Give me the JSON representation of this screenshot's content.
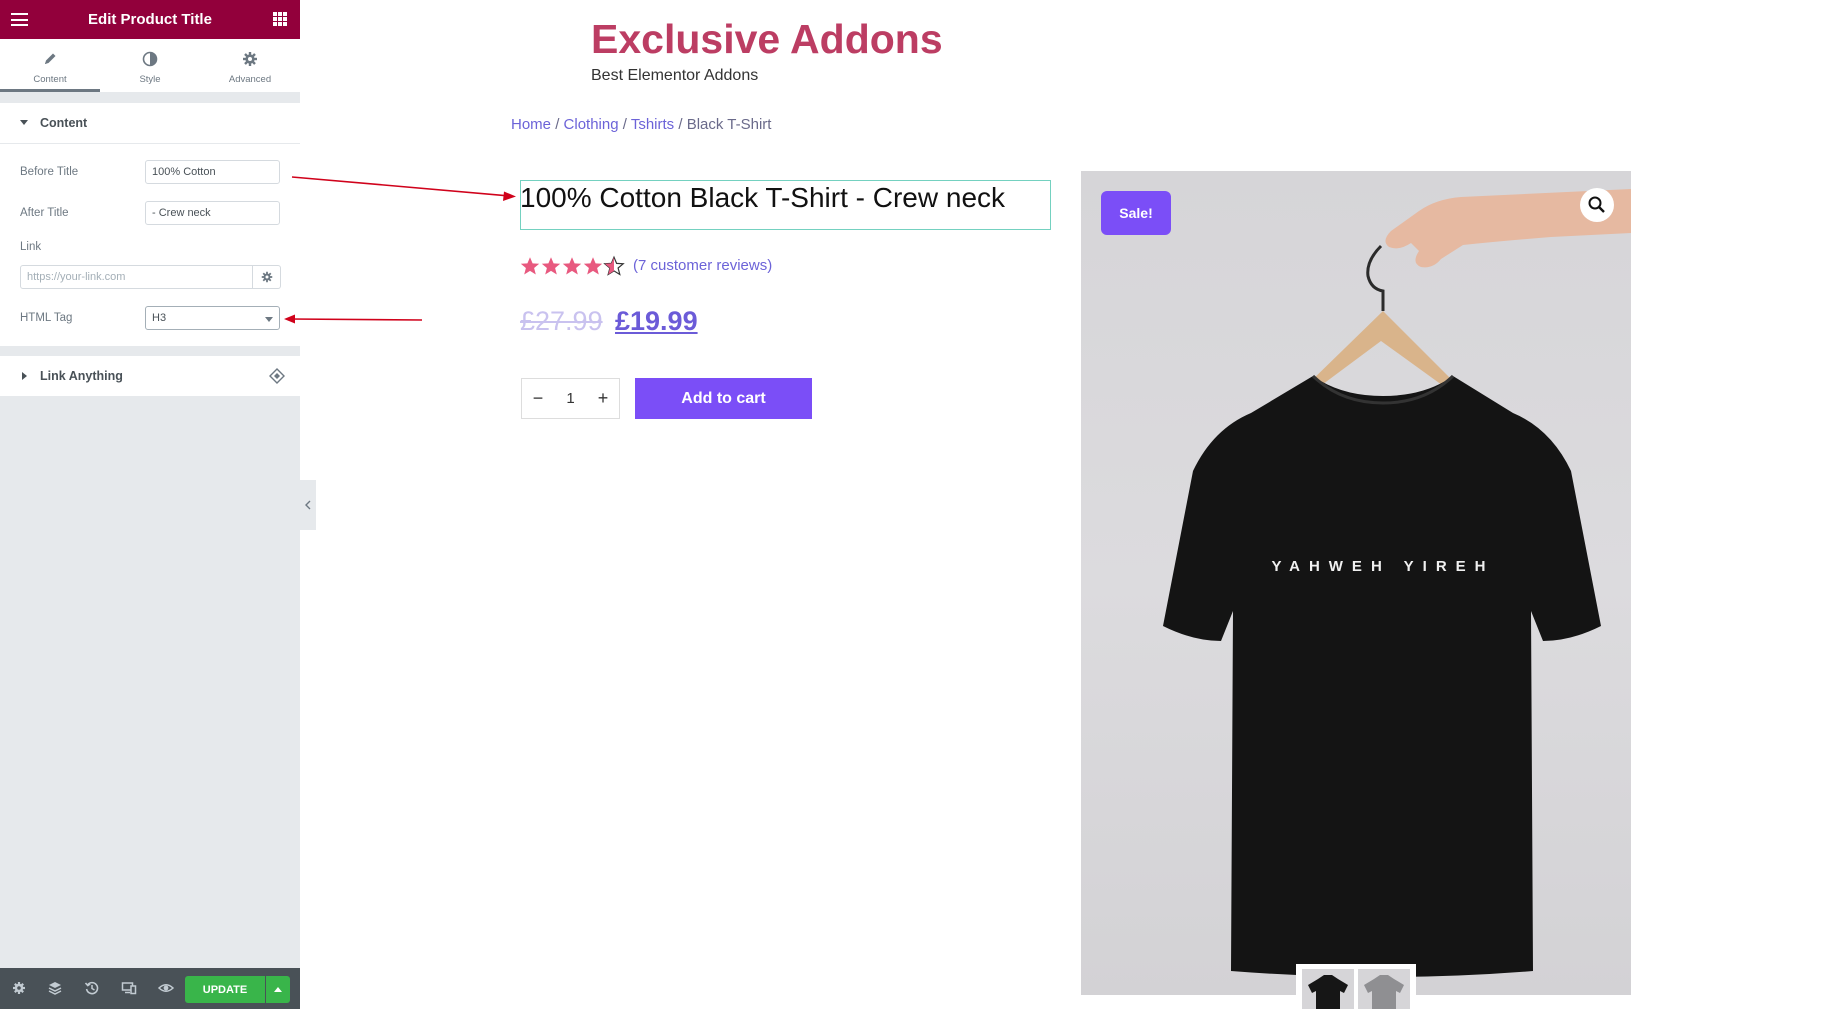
{
  "panel": {
    "title": "Edit Product Title",
    "tabs": [
      {
        "label": "Content",
        "icon": "pencil-icon",
        "active": true
      },
      {
        "label": "Style",
        "icon": "half-circle-icon",
        "active": false
      },
      {
        "label": "Advanced",
        "icon": "gear-icon",
        "active": false
      }
    ],
    "content_section": {
      "label": "Content",
      "expanded": true,
      "before_title_label": "Before Title",
      "before_title_value": "100% Cotton",
      "after_title_label": "After Title",
      "after_title_value": "- Crew neck",
      "link_label": "Link",
      "link_placeholder": "https://your-link.com",
      "html_tag_label": "HTML Tag",
      "html_tag_value": "H3"
    },
    "link_anything_section": {
      "label": "Link Anything",
      "expanded": false
    },
    "footer": {
      "update_label": "UPDATE",
      "update_color": "#39b54a"
    }
  },
  "site": {
    "title": "Exclusive Addons",
    "tagline": "Best Elementor Addons",
    "title_color": "#bc3d63"
  },
  "breadcrumb": {
    "items": [
      "Home",
      "Clothing",
      "Tshirts"
    ],
    "current": "Black T-Shirt",
    "separator": "/"
  },
  "product": {
    "title": "100% Cotton Black T-Shirt - Crew neck",
    "rating": 4.5,
    "rating_max": 5,
    "reviews_text": "(7 customer reviews)",
    "price_old": "£27.99",
    "price_new": "£19.99",
    "quantity": "1",
    "add_to_cart_label": "Add to cart",
    "sale_badge": "Sale!",
    "shirt_print": "YAHWEH YIREH",
    "accent_color": "#7b4ef7",
    "star_color": "#e8597f"
  }
}
